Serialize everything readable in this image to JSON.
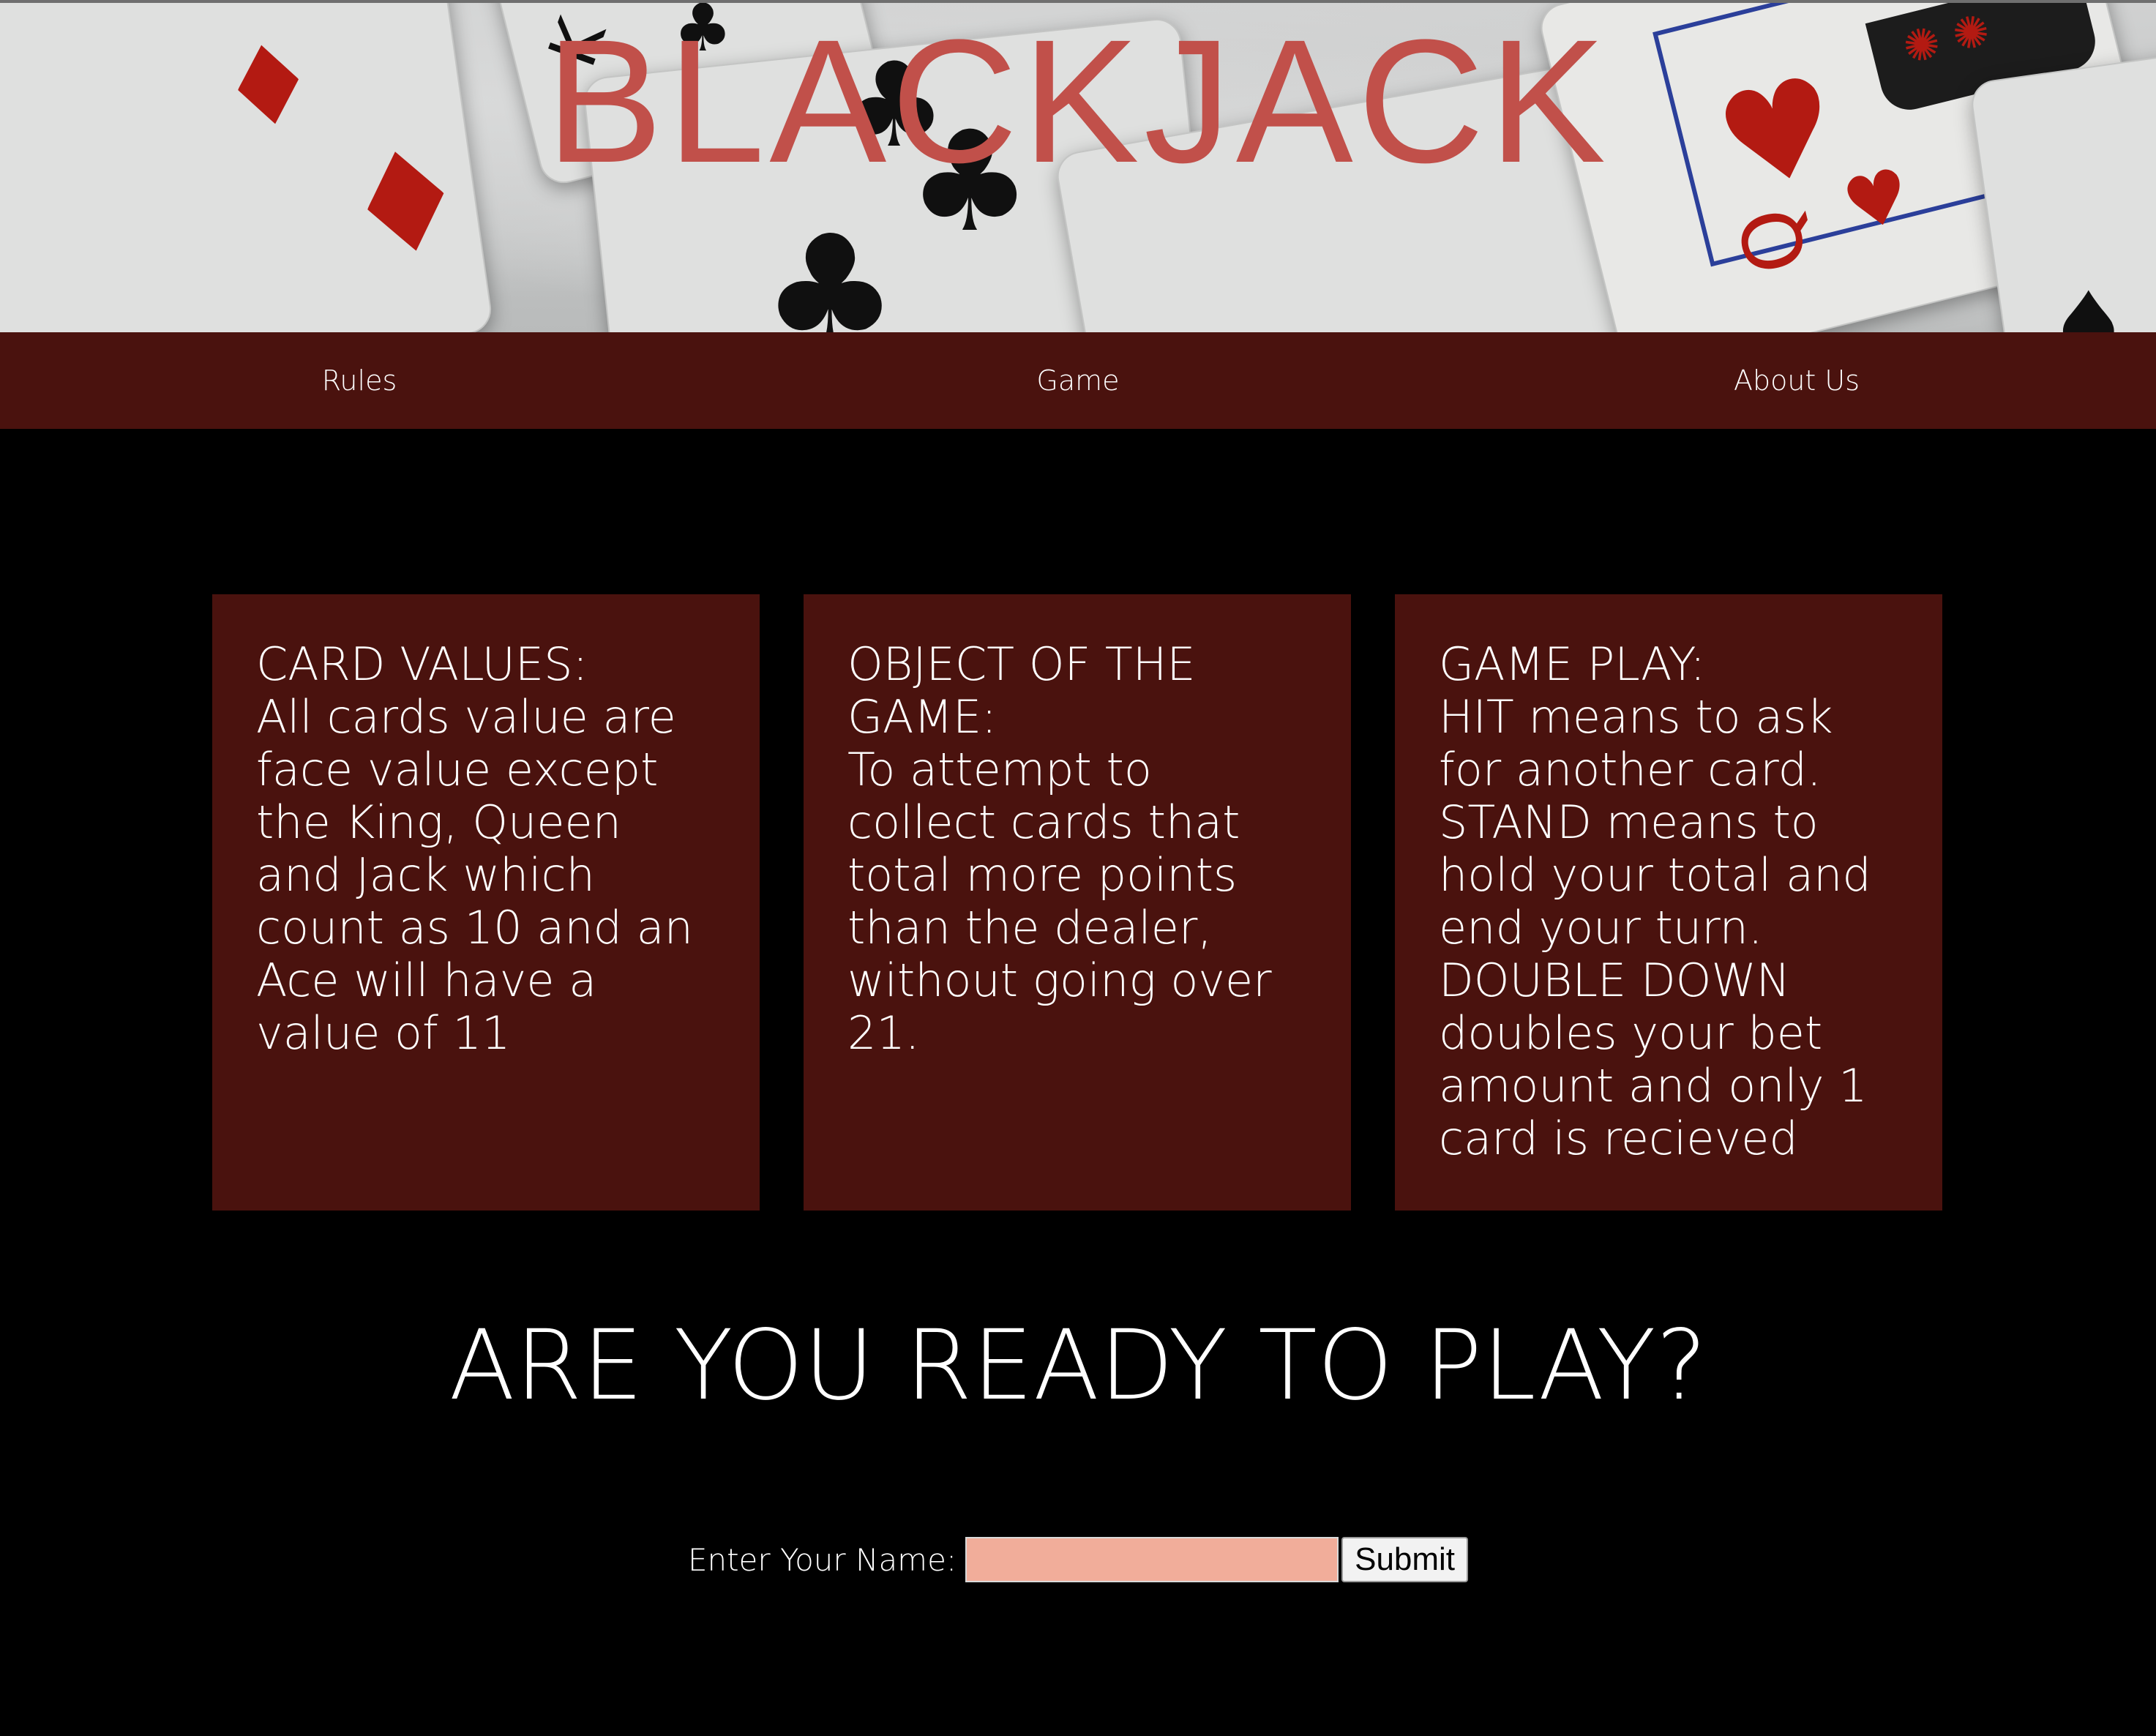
{
  "hero": {
    "title": "BLACKJACK"
  },
  "nav": {
    "items": [
      {
        "label": "Rules"
      },
      {
        "label": "Game"
      },
      {
        "label": "About Us"
      }
    ]
  },
  "boxes": [
    {
      "title": "CARD VALUES:",
      "body": "All cards value are face value except the King, Queen and Jack which count as 10 and an Ace will have a value of 11"
    },
    {
      "title": "OBJECT OF THE GAME:",
      "body": "To attempt to collect cards that total more points than the dealer, without going over 21."
    },
    {
      "title": "GAME PLAY:",
      "body": "HIT means to ask for another card. STAND means to hold your total and end your turn. DOUBLE DOWN doubles your bet amount and only 1 card is recieved"
    }
  ],
  "cta": {
    "heading": "ARE YOU READY TO PLAY?"
  },
  "form": {
    "label": "Enter Your Name:",
    "input_value": "",
    "submit_label": "Submit"
  },
  "colors": {
    "title": "#c1504a",
    "nav_bg": "#4a120e",
    "box_bg": "#4a120e",
    "page_bg": "#000000",
    "input_bg": "#f1ad9a"
  },
  "icons": {
    "hero_background": "playing-cards-photo"
  }
}
